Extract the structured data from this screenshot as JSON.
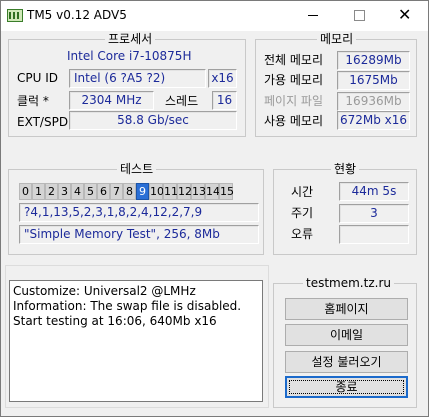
{
  "window": {
    "title": "TM5 v0.12 ADV5",
    "close_glyph": "✕"
  },
  "cpu": {
    "group_title": "프로세서",
    "model": "Intel Core i7-10875H",
    "cpuid_label": "CPU ID",
    "cpuid_value": "Intel  (6 ?A5 ?2)",
    "cpuid_threads": "x16",
    "clock_label": "클럭 *",
    "clock_value": "2304 MHz",
    "threads_label": "스레드",
    "threads_value": "16",
    "ext_label": "EXT/SPD",
    "ext_value": "58.8 Gb/sec"
  },
  "memory": {
    "group_title": "메모리",
    "total_label": "전체 메모리",
    "total_value": "16289Mb",
    "avail_label": "가용 메모리",
    "avail_value": "1675Mb",
    "pagefile_label": "페이지 파일",
    "pagefile_value": "16936Mb",
    "used_label": "사용 메모리",
    "used_value": "672Mb x16"
  },
  "tests": {
    "group_title": "테스트",
    "cells": [
      "0",
      "1",
      "2",
      "3",
      "4",
      "5",
      "6",
      "7",
      "8",
      "9",
      "10",
      "11",
      "12",
      "13",
      "14",
      "15"
    ],
    "active_index": 9,
    "sequence": "?4,1,13,5,2,3,1,8,2,4,12,2,7,9",
    "config": "\"Simple Memory Test\", 256, 8Mb"
  },
  "status": {
    "group_title": "현황",
    "time_label": "시간",
    "time_value": "44m 5s",
    "cycle_label": "주기",
    "cycle_value": "3",
    "errors_label": "오류",
    "errors_value": ""
  },
  "log": {
    "lines": [
      "Customize: Universal2 @LMHz",
      "Information: The swap file is disabled.",
      "Start testing at 16:06, 640Mb x16"
    ]
  },
  "side": {
    "site": "testmem.tz.ru",
    "homepage": "홈페이지",
    "email": "이메일",
    "load_settings": "설정 불러오기",
    "exit": "종료"
  },
  "colors": {
    "accent": "#2a6fd6",
    "value_blue": "#1c2a9a"
  }
}
